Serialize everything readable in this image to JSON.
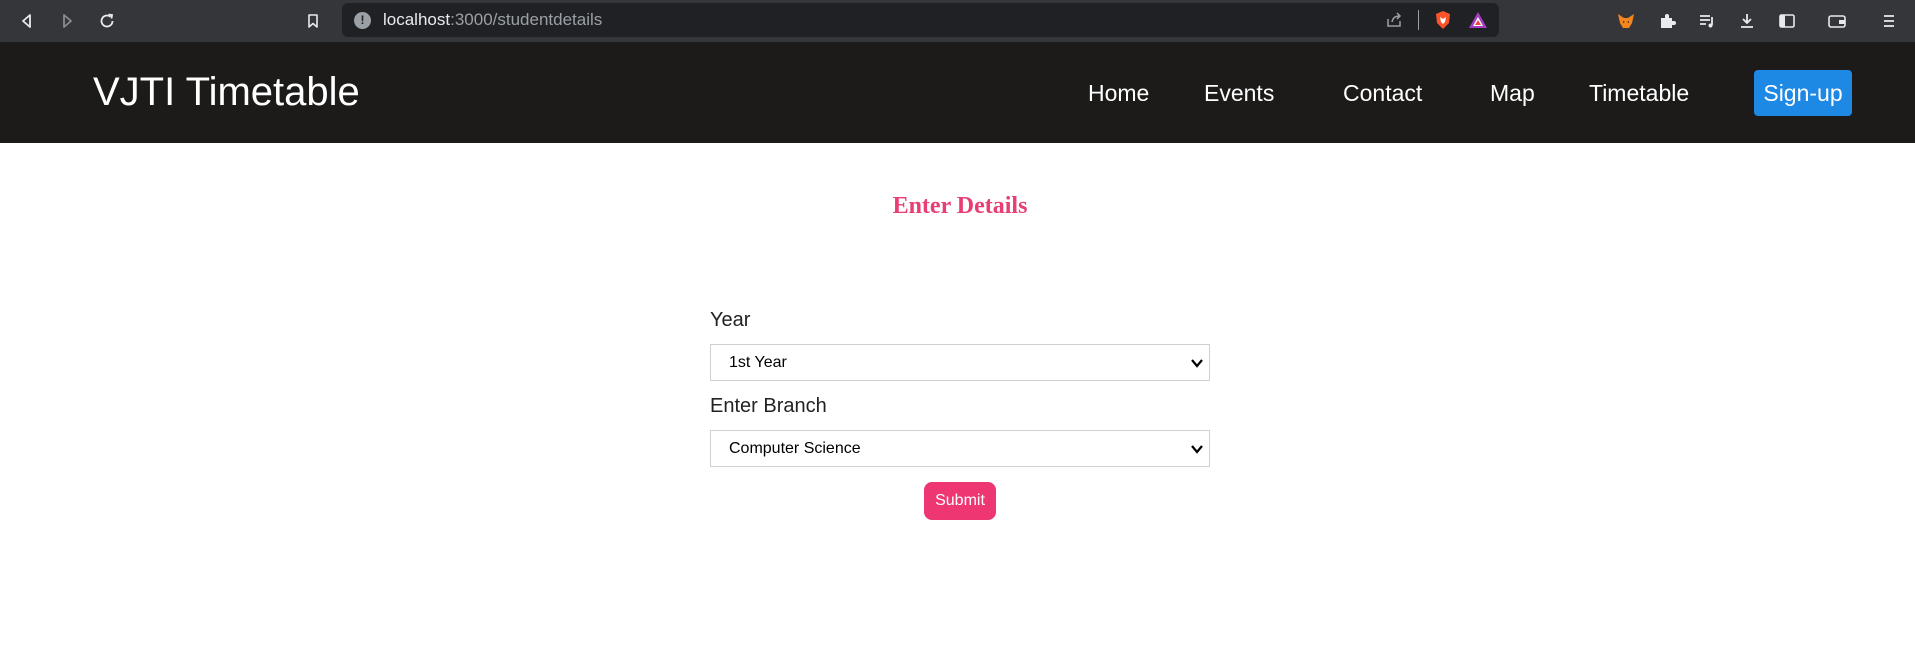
{
  "browser": {
    "url_host": "localhost",
    "url_path": ":3000/studentdetails"
  },
  "navbar": {
    "brand": "VJTI Timetable",
    "links": [
      "Home",
      "Events",
      "Contact",
      "Map",
      "Timetable"
    ],
    "signup_label": "Sign-up",
    "signup_color": "#1e88e5"
  },
  "form": {
    "heading": "Enter Details",
    "heading_color": "#e83e73",
    "year_label": "Year",
    "year_value": "1st Year",
    "branch_label": "Enter Branch",
    "branch_value": "Computer Science",
    "submit_label": "Submit",
    "submit_color": "#ee3672"
  }
}
